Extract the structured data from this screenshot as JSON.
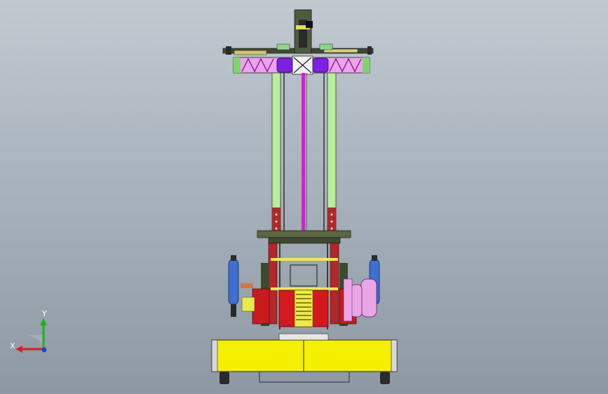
{
  "viewport": {
    "triad": {
      "x_label": "X",
      "y_label": "Y",
      "x_color": "#e11b1b",
      "y_color": "#18b418",
      "z_color": "#1b3ee1"
    }
  },
  "model": {
    "colors": {
      "base": "#f4f000",
      "mast_left": "#b9ef9b",
      "mast_center": "#d51cd6",
      "mast_rivets": "#b3262a",
      "truss": "#efa2ef",
      "cylinder": "#7e1fe8",
      "blue_tank": "#3f6fd3",
      "pink_tank": "#e9a6e7",
      "red_motor": "#d3181e",
      "frame": "#3a4a2d"
    }
  }
}
